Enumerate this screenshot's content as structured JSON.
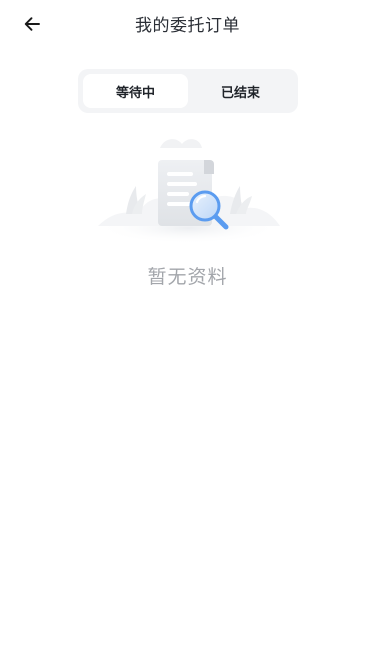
{
  "header": {
    "title": "我的委托订单",
    "back_icon": "arrow-left-icon"
  },
  "tabs": [
    {
      "label": "等待中",
      "active": true
    },
    {
      "label": "已结束",
      "active": false
    }
  ],
  "empty_state": {
    "illustration": "empty-document-search-illustration",
    "message": "暂无资料"
  },
  "colors": {
    "tab_track": "#f3f4f6",
    "empty_text": "#a3a6ab",
    "magnifier_accent": "#5b9cf0"
  }
}
